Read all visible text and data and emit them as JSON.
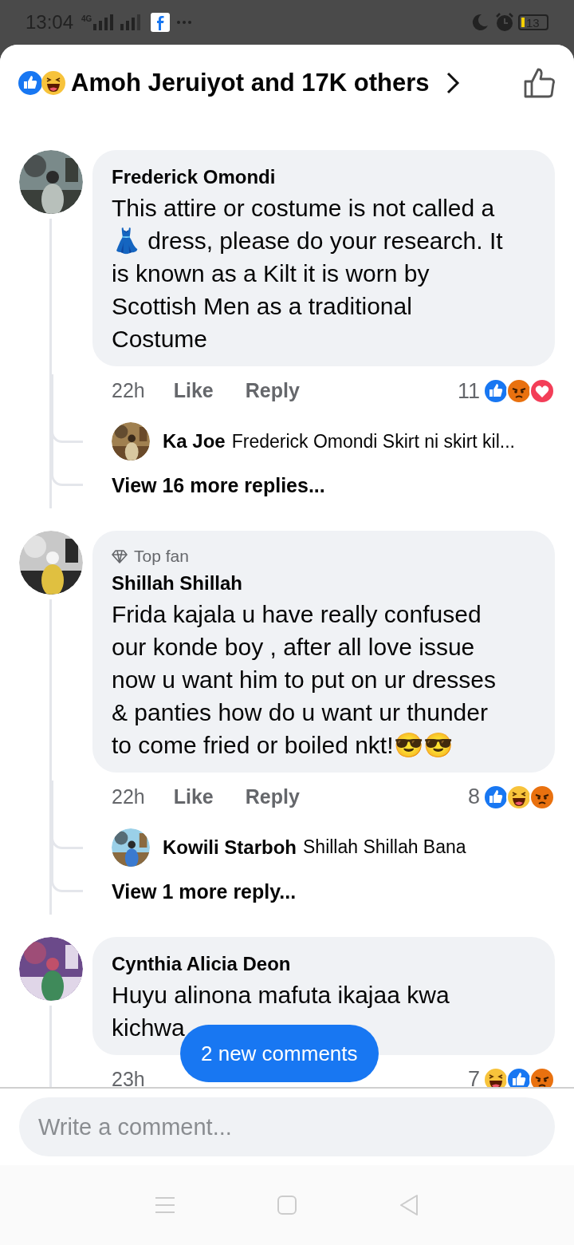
{
  "status_bar": {
    "time": "13:04",
    "network": "4G",
    "battery": "13"
  },
  "header": {
    "reactions": [
      {
        "kind": "like"
      },
      {
        "kind": "haha"
      }
    ],
    "title": "Amoh Jeruiyot and 17K others"
  },
  "comments": [
    {
      "author": "Frederick Omondi",
      "text": "This attire or costume is not called a 👗 dress, please do your research. It is known as a Kilt it is worn by Scottish Men as a traditional Costume",
      "time": "22h",
      "like": "Like",
      "reply": "Reply",
      "count": "11",
      "reactions": [
        {
          "kind": "like"
        },
        {
          "kind": "angry"
        },
        {
          "kind": "love"
        }
      ],
      "replies": [
        {
          "author": "Ka Joe",
          "text": "Frederick Omondi Skirt ni skirt kil..."
        }
      ],
      "more": "View 16 more replies..."
    },
    {
      "author": "Shillah Shillah",
      "top_fan": "Top fan",
      "text": "Frida kajala u have really confused our konde boy , after all love issue now u want him to put on ur dresses & panties how do u want ur thunder to come fried or boiled nkt!😎😎",
      "time": "22h",
      "like": "Like",
      "reply": "Reply",
      "count": "8",
      "reactions": [
        {
          "kind": "like"
        },
        {
          "kind": "haha"
        },
        {
          "kind": "angry"
        }
      ],
      "replies": [
        {
          "author": "Kowili Starboh",
          "text": "Shillah Shillah Bana"
        }
      ],
      "more": "View 1 more reply..."
    },
    {
      "author": "Cynthia Alicia Deon",
      "text": "Huyu alinona mafuta ikajaa kwa kichwa",
      "time": "23h",
      "count": "7",
      "reactions": [
        {
          "kind": "haha"
        },
        {
          "kind": "like"
        },
        {
          "kind": "angry"
        }
      ]
    }
  ],
  "new_comments": "2 new comments",
  "composer": {
    "placeholder": "Write a comment..."
  }
}
